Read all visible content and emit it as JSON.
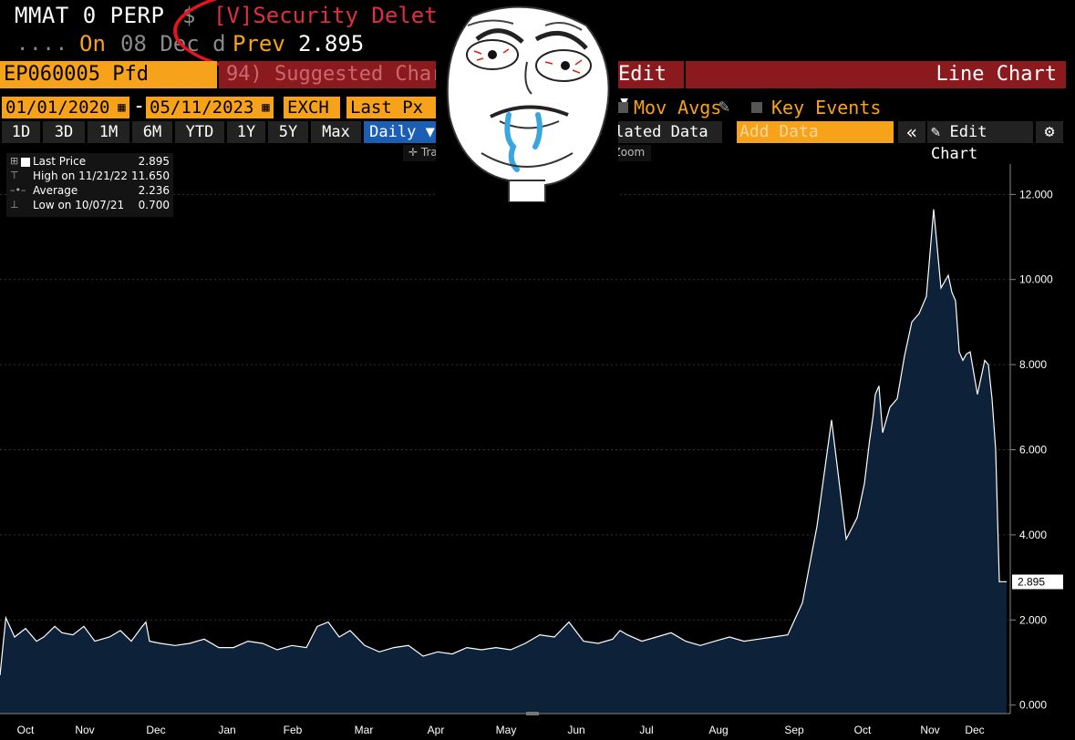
{
  "header": {
    "ticker": "MMAT 0 PERP",
    "currency": "$",
    "status": "[V]Security Deleted",
    "dots": "....",
    "on_label": "On",
    "on_date": "08 Dec d",
    "prev_label": "Prev",
    "prev_value": "2.895"
  },
  "toolbar_row1": {
    "security": "EP060005 Pfd",
    "suggested": "94) Suggested Charts",
    "edit": "Edit ▾",
    "title": "Line Chart"
  },
  "toolbar_row2": {
    "start_date": "01/01/2020",
    "end_date": "05/11/2023",
    "dash": "-",
    "exch": "EXCH",
    "field": "Last Px",
    "mov_avgs": "Mov Avgs",
    "key_events": "Key Events"
  },
  "toolbar_row3": {
    "periods": [
      "1D",
      "3D",
      "1M",
      "6M",
      "YTD",
      "1Y",
      "5Y",
      "Max"
    ],
    "frequency": "Daily ▼",
    "related": "elated Data ▾",
    "add_data_placeholder": "Add Data",
    "edit_chart": "Edit Chart"
  },
  "zoombar": {
    "track": "Track",
    "zoom": "Zoom"
  },
  "legend": [
    {
      "name": "Last Price",
      "value": "2.895"
    },
    {
      "name": "High on 11/21/22",
      "value": "11.650"
    },
    {
      "name": "Average",
      "value": "2.236"
    },
    {
      "name": "Low on 10/07/21",
      "value": "0.700"
    }
  ],
  "colors": {
    "accent_orange": "#f7a21b",
    "deleted_red": "#e0303c",
    "bar_red": "#8b1a1f",
    "area_fill": "#0d2138",
    "selected_blue": "#1a5fb4"
  },
  "icons": [
    "calendar-icon",
    "pencil-icon",
    "gear-icon",
    "double-left-arrow-icon",
    "crosshair-icon",
    "magnifier-icon",
    "rage-face-meme"
  ],
  "chart_data": {
    "type": "area",
    "x_labels": [
      "Oct",
      "Nov",
      "Dec",
      "Jan",
      "Feb",
      "Mar",
      "Apr",
      "May",
      "Jun",
      "Jul",
      "Aug",
      "Sep",
      "Oct",
      "Nov",
      "Dec"
    ],
    "y_ticks": [
      "0.000",
      "2.000",
      "4.000",
      "6.000",
      "8.000",
      "10.000",
      "12.000"
    ],
    "ylim": [
      -0.2,
      12.5
    ],
    "last_value_label": "2.895",
    "series": [
      {
        "x": [
          0.0,
          0.08,
          0.2,
          0.35,
          0.5,
          0.6,
          0.75,
          0.85,
          1.0,
          1.15,
          1.3,
          1.5,
          1.65,
          1.8,
          1.95,
          2.0,
          2.05,
          2.2,
          2.4,
          2.6,
          2.8,
          3.0,
          3.2,
          3.4,
          3.6,
          3.8,
          4.0,
          4.2,
          4.35,
          4.5,
          4.65,
          4.8,
          5.0,
          5.2,
          5.4,
          5.6,
          5.8,
          6.0,
          6.2,
          6.4,
          6.6,
          6.8,
          7.0,
          7.2,
          7.4,
          7.6,
          7.8,
          8.0,
          8.2,
          8.4,
          8.5,
          8.6,
          8.8,
          9.0,
          9.2,
          9.4,
          9.6,
          9.8,
          10.0,
          10.2,
          10.4,
          10.6,
          10.8,
          11.0,
          11.2,
          11.4,
          11.6,
          11.75,
          11.85,
          11.92,
          11.97,
          12.0,
          12.05,
          12.1,
          12.2,
          12.3,
          12.4,
          12.5,
          12.6,
          12.7,
          12.8,
          12.9,
          13.0,
          13.05,
          13.1,
          13.15,
          13.2,
          13.25,
          13.3,
          13.4,
          13.5,
          13.55,
          13.6,
          13.65,
          13.7,
          13.72,
          13.75,
          13.78,
          13.8
        ],
        "y": [
          0.7,
          2.05,
          1.6,
          1.8,
          1.5,
          1.6,
          1.85,
          1.7,
          1.65,
          1.85,
          1.5,
          1.6,
          1.75,
          1.5,
          1.85,
          1.95,
          1.5,
          1.45,
          1.4,
          1.45,
          1.55,
          1.35,
          1.35,
          1.5,
          1.45,
          1.3,
          1.4,
          1.35,
          1.85,
          1.95,
          1.6,
          1.75,
          1.4,
          1.25,
          1.35,
          1.4,
          1.15,
          1.25,
          1.2,
          1.35,
          1.3,
          1.35,
          1.3,
          1.45,
          1.65,
          1.6,
          1.95,
          1.5,
          1.45,
          1.55,
          1.75,
          1.65,
          1.5,
          1.6,
          1.7,
          1.5,
          1.4,
          1.5,
          1.6,
          1.5,
          1.55,
          1.6,
          1.65,
          2.4,
          4.2,
          6.7,
          3.9,
          4.4,
          5.2,
          6.2,
          6.8,
          7.3,
          7.5,
          6.4,
          7.0,
          7.2,
          8.2,
          9.0,
          9.2,
          9.6,
          11.65,
          9.8,
          10.1,
          9.7,
          9.5,
          8.3,
          8.1,
          8.25,
          8.3,
          7.3,
          8.1,
          8.0,
          7.2,
          6.0,
          2.895,
          2.9,
          2.9,
          2.9,
          2.895
        ]
      }
    ]
  }
}
